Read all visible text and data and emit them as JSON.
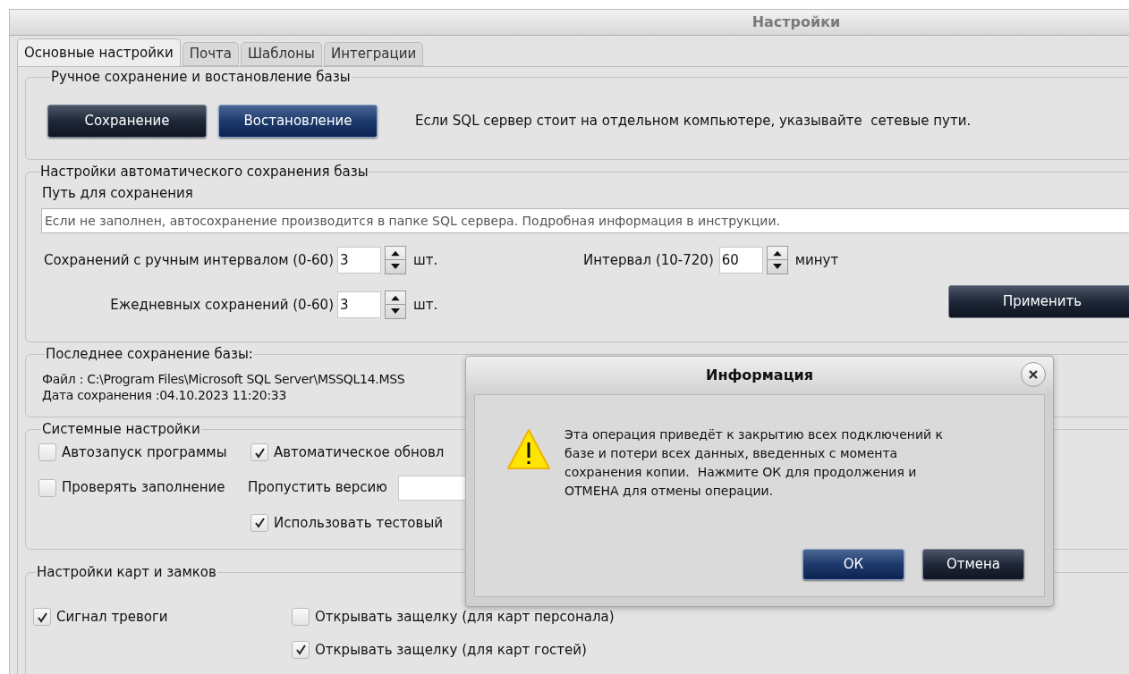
{
  "window": {
    "title": "Настройки"
  },
  "tabs": [
    {
      "label": "Основные настройки",
      "selected": true
    },
    {
      "label": "Почта",
      "selected": false
    },
    {
      "label": "Шаблоны",
      "selected": false
    },
    {
      "label": "Интеграции",
      "selected": false
    }
  ],
  "manual_backup": {
    "title": "Ручное сохранение и востановление базы",
    "buttons": [
      {
        "label": "Сохранение",
        "focused": false
      },
      {
        "label": "Востановление",
        "focused": true
      }
    ],
    "note": "Если SQL сервер стоит на отдельном компьютере, указывайте  сетевые пути."
  },
  "auto_backup": {
    "title": "Настройки автоматического сохранения базы",
    "path_label": "Путь для сохранения",
    "path_placeholder": "Если не заполнен, автосохранение производится в папке SQL сервера. Подробная информация в инструкции.",
    "manual_count": {
      "label": "Сохранений с ручным интервалом (0-60)",
      "value": "3",
      "unit": "шт."
    },
    "interval": {
      "label": "Интервал (10-720)",
      "value": "60",
      "unit": "минут"
    },
    "daily_count": {
      "label": "Ежедневных сохранений (0-60)",
      "value": "3",
      "unit": "шт."
    },
    "apply": "Применить"
  },
  "last_backup": {
    "title": "Последнее сохранение базы:",
    "file": "Файл : C:\\Program Files\\Microsoft SQL Server\\MSSQL14.MSS",
    "date": "Дата сохранения :04.10.2023 11:20:33"
  },
  "system": {
    "title": "Системные настройки",
    "autostart": {
      "label": "Автозапуск программы",
      "checked": false
    },
    "check_fill": {
      "label": "Проверять заполнение",
      "checked": false
    },
    "auto_update": {
      "label": "Автоматическое обновл",
      "checked": true
    },
    "skip_version": {
      "label": "Пропустить версию"
    },
    "test_server": {
      "label": "Использовать тестовый",
      "checked": true
    }
  },
  "cards": {
    "title": "Настройки карт и замков",
    "alarm": {
      "label": "Сигнал тревоги",
      "checked": true
    },
    "latch_staff": {
      "label": "Открывать защелку (для карт персонала)",
      "checked": false
    },
    "latch_guest": {
      "label": "Открывать защелку (для карт гостей)",
      "checked": true
    }
  },
  "dialog": {
    "title": "Информация",
    "message": "Эта операция приведёт к закрытию всех подключений к базе и потери всех данных, введенных с момента сохранения копии.  Нажмите ОК для продолжения и ОТМЕНА для отмены операции.",
    "buttons": [
      {
        "label": "ОК",
        "focused": true
      },
      {
        "label": "Отмена",
        "focused": false
      }
    ]
  }
}
